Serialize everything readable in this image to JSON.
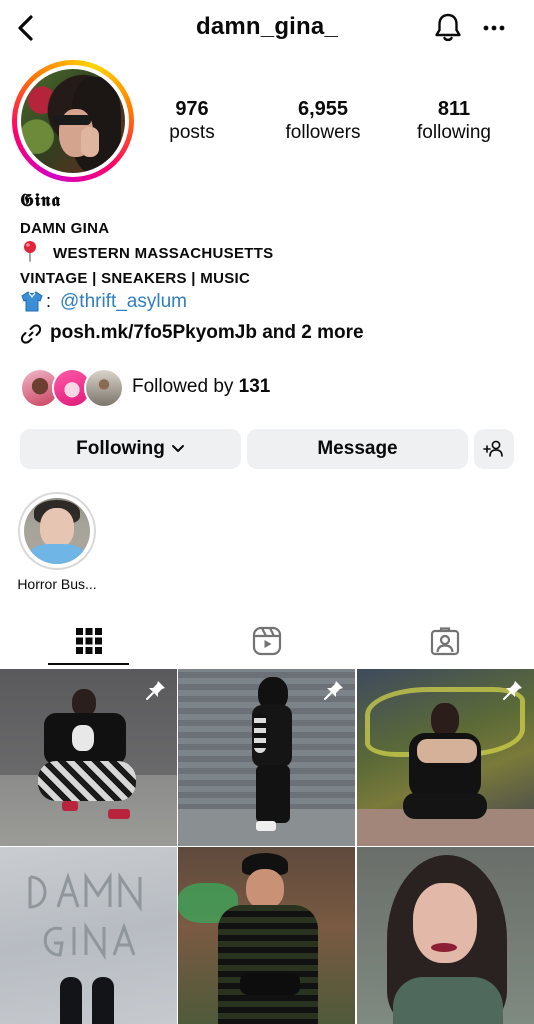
{
  "header": {
    "username": "damn_gina_",
    "back_icon": "chevron-left-icon",
    "bell_icon": "bell-icon",
    "more_icon": "more-horizontal-icon"
  },
  "stats": [
    {
      "value": "976",
      "label": "posts"
    },
    {
      "value": "6,955",
      "label": "followers"
    },
    {
      "value": "811",
      "label": "following"
    }
  ],
  "bio": {
    "display_name": "𝕲𝖎𝖓𝖆",
    "name_line": "DAMN GINA",
    "location_icon": "round-pushpin-icon",
    "location": "WESTERN MASSACHUSETTS",
    "tagline": "VINTAGE | SNEAKERS | MUSIC",
    "shirt_icon": "tshirt-icon",
    "colon": ":",
    "mention": "@thrift_asylum",
    "link_icon": "link-icon",
    "link": "posh.mk/7fo5PkyomJb and 2 more"
  },
  "followed_by": {
    "prefix": "Followed by ",
    "count": "131"
  },
  "actions": {
    "following_label": "Following",
    "message_label": "Message",
    "add_user_icon": "add-user-icon"
  },
  "highlights": [
    {
      "label": "Horror Bus..."
    }
  ],
  "tabs": [
    {
      "name": "posts-grid",
      "icon": "grid-icon"
    },
    {
      "name": "reels",
      "icon": "reels-icon"
    },
    {
      "name": "tagged",
      "icon": "tagged-person-icon"
    }
  ],
  "colors": {
    "accent_link": "#2f7ec4",
    "button_bg": "#eff0f2",
    "text": "#0a0a0a"
  }
}
